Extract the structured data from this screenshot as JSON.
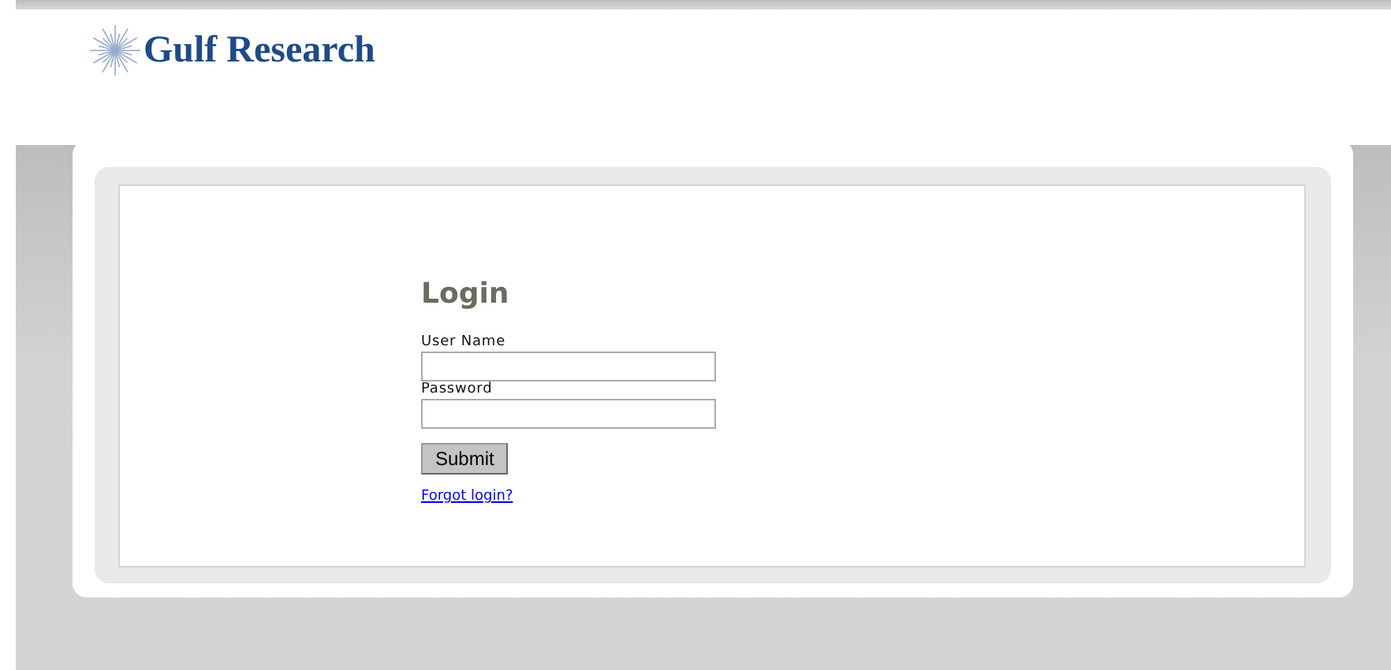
{
  "logo": {
    "text": "Gulf Research"
  },
  "login": {
    "title": "Login",
    "fields": [
      {
        "label": "User Name"
      },
      {
        "label": "Password"
      }
    ],
    "submit": "Submit",
    "forgot_link": "Forgot login?"
  }
}
